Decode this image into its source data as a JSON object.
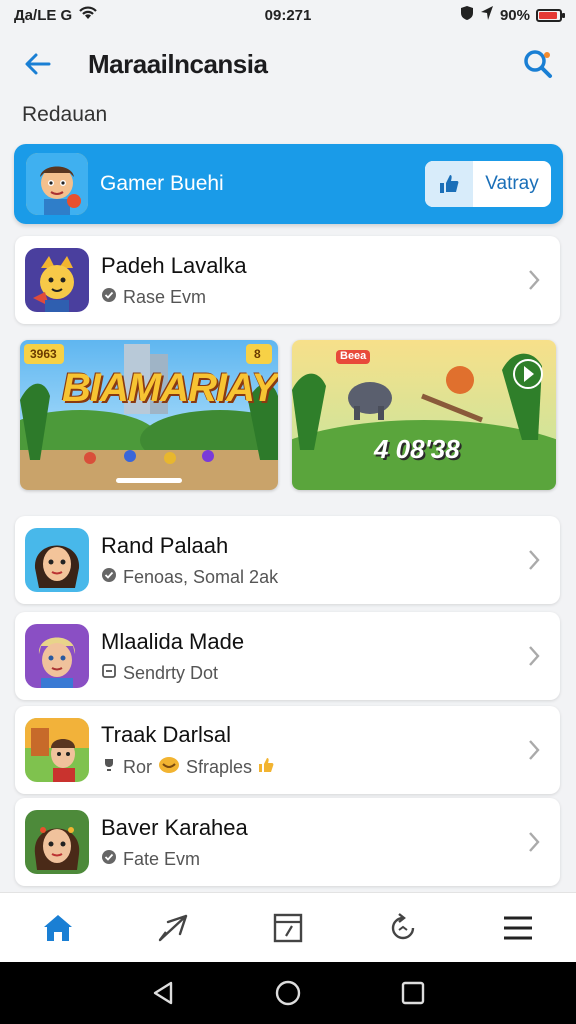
{
  "status_bar": {
    "carrier": "Да/LE G",
    "time": "09:271",
    "battery": "90%",
    "battery_level": 0.9
  },
  "header": {
    "title": "Maraailncansia",
    "back_icon": "arrow-left-icon",
    "search_icon": "search-icon"
  },
  "section": {
    "label": "Redauan"
  },
  "featured": {
    "name": "Gamer Buehi",
    "button_label": "Vatray",
    "button_icon": "thumbs-up-icon"
  },
  "first_item": {
    "name": "Padeh Lavalka",
    "subtitle": "Rase Evm"
  },
  "banners": [
    {
      "title": "BIAMARIAY",
      "badge_left": "3963",
      "badge_right": "8"
    },
    {
      "title": "4 08'38",
      "tag": "Beea"
    }
  ],
  "items": [
    {
      "name": "Rand Palaah",
      "subtitle": "Fenoas, Somal 2ak"
    },
    {
      "name": "Mlaalida Made",
      "subtitle": "Sendrty Dot"
    },
    {
      "name": "Traak Darlsal",
      "subtitle": "Ror",
      "subtitle_extra": "Sfraples"
    },
    {
      "name": "Baver Karahea",
      "subtitle": "Fate Evm"
    }
  ],
  "bottom_nav": [
    "home-icon",
    "send-icon",
    "edit-icon",
    "refresh-icon",
    "menu-icon"
  ],
  "colors": {
    "accent": "#1a9be8",
    "background": "#f2f3f5",
    "battery_low": "#e53935"
  }
}
